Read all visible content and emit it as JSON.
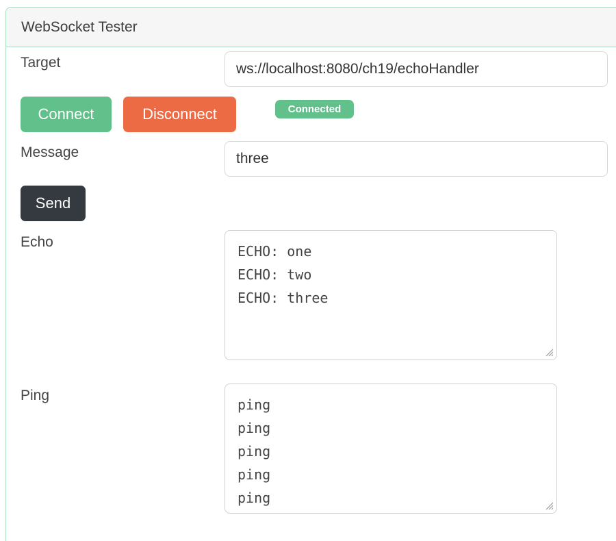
{
  "app": {
    "title": "WebSocket Tester"
  },
  "target": {
    "label": "Target",
    "value": "ws://localhost:8080/ch19/echoHandler"
  },
  "buttons": {
    "connect": "Connect",
    "disconnect": "Disconnect",
    "send": "Send"
  },
  "status": {
    "text": "Connected",
    "color": "#62c08b"
  },
  "message": {
    "label": "Message",
    "value": "three"
  },
  "echo": {
    "label": "Echo",
    "lines": [
      "ECHO: one",
      "ECHO: two",
      "ECHO: three"
    ]
  },
  "ping": {
    "label": "Ping",
    "lines": [
      "ping",
      "ping",
      "ping",
      "ping",
      "ping"
    ]
  },
  "colors": {
    "accent_green": "#62c08b",
    "disconnect_orange": "#ec6b45",
    "send_dark": "#343a40",
    "card_border": "#a9d8bf"
  }
}
